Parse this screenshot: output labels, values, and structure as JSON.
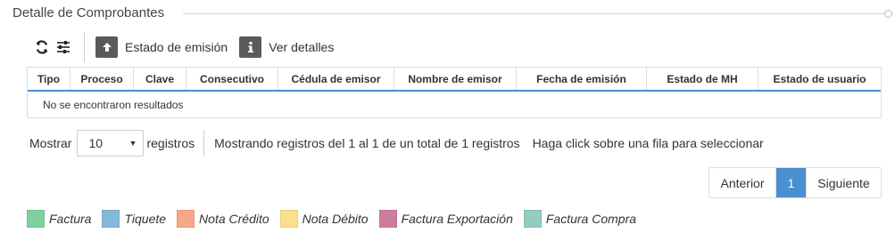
{
  "section": {
    "title": "Detalle de Comprobantes"
  },
  "toolbar": {
    "refresh_icon": "refresh-icon",
    "settings_icon": "sliders-icon",
    "upload_icon": "arrow-up-icon",
    "info_icon": "info-icon",
    "estado_label": "Estado de emisión",
    "detalles_label": "Ver detalles"
  },
  "grid": {
    "columns": [
      "Tipo",
      "Proceso",
      "Clave",
      "Consecutivo",
      "Cédula de emisor",
      "Nombre de emisor",
      "Fecha de emisión",
      "Estado de MH",
      "Estado de usuario"
    ],
    "empty_message": "No se encontraron resultados",
    "header_accent": "#4a8fd1"
  },
  "pager": {
    "show_label": "Mostrar",
    "page_size": "10",
    "records_label": "registros",
    "info_text": "Mostrando registros del 1 al 1 de un total de 1 registros",
    "hint_text": "Haga click sobre una fila para seleccionar",
    "prev_label": "Anterior",
    "current_page": "1",
    "next_label": "Siguiente",
    "active_color": "#4a8fd1"
  },
  "legend": [
    {
      "label": "Factura",
      "color": "#7fcf9f"
    },
    {
      "label": "Tiquete",
      "color": "#86b8da"
    },
    {
      "label": "Nota Crédito",
      "color": "#f6a889"
    },
    {
      "label": "Nota Débito",
      "color": "#fbe08b"
    },
    {
      "label": "Factura Exportación",
      "color": "#cc7d9e"
    },
    {
      "label": "Factura Compra",
      "color": "#93ccc2"
    }
  ]
}
